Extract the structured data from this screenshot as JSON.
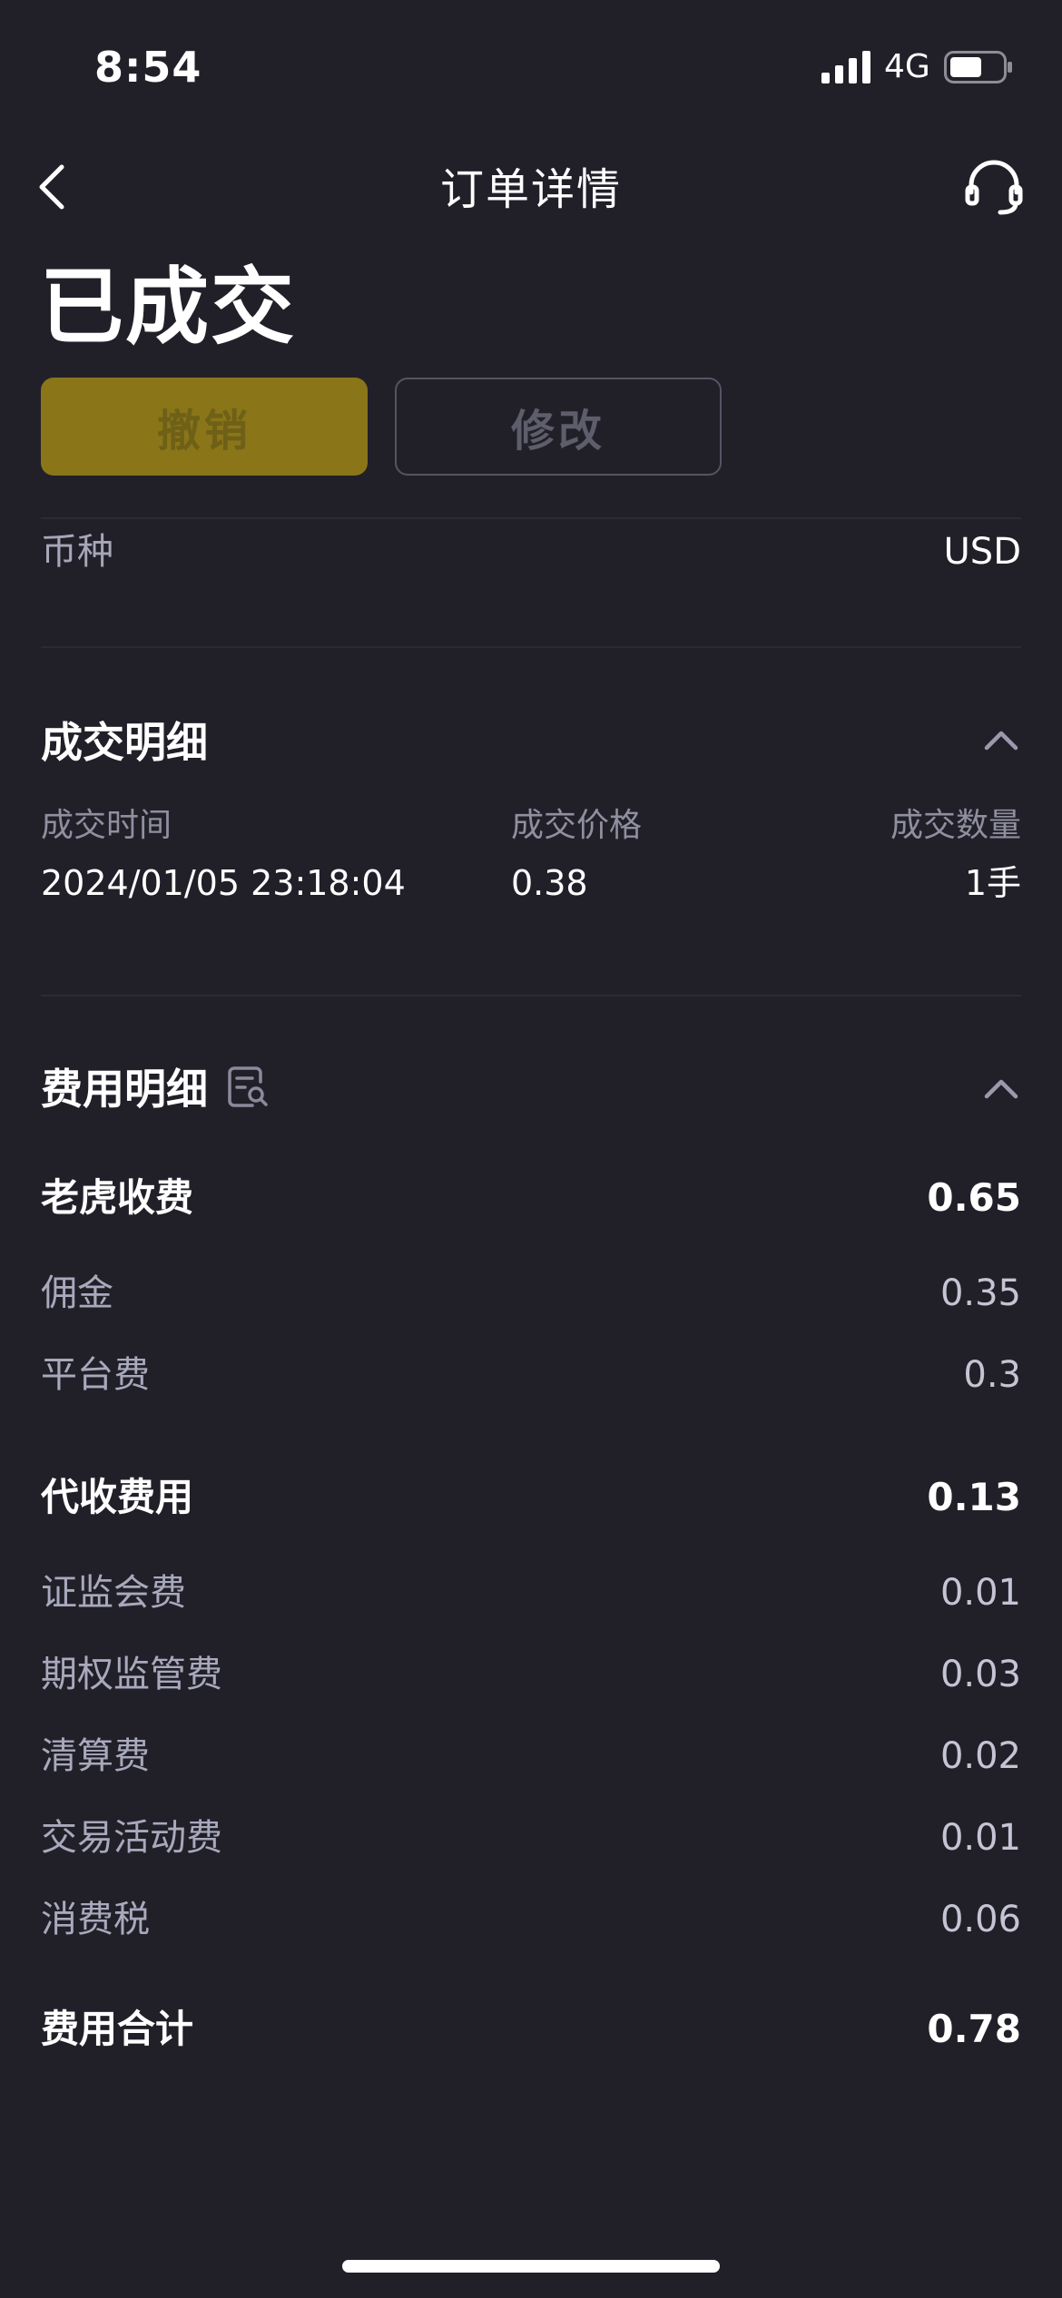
{
  "status_bar": {
    "time": "8:54",
    "network": "4G"
  },
  "nav": {
    "title": "订单详情",
    "back_icon": "chevron-left-icon",
    "support_icon": "headset-icon"
  },
  "order": {
    "status": "已成交",
    "cancel_label": "撤销",
    "modify_label": "修改",
    "currency_label": "币种",
    "currency_value": "USD"
  },
  "trade_details": {
    "title": "成交明细",
    "columns": [
      "成交时间",
      "成交价格",
      "成交数量"
    ],
    "rows": [
      {
        "time": "2024/01/05 23:18:04",
        "price": "0.38",
        "quantity": "1手"
      }
    ]
  },
  "fee_details": {
    "title": "费用明细",
    "info_icon": "document-search-icon",
    "tiger_fees": {
      "label": "老虎收费",
      "total": "0.65",
      "items": [
        {
          "label": "佣金",
          "value": "0.35"
        },
        {
          "label": "平台费",
          "value": "0.3"
        }
      ]
    },
    "collected_fees": {
      "label": "代收费用",
      "total": "0.13",
      "items": [
        {
          "label": "证监会费",
          "value": "0.01"
        },
        {
          "label": "期权监管费",
          "value": "0.03"
        },
        {
          "label": "清算费",
          "value": "0.02"
        },
        {
          "label": "交易活动费",
          "value": "0.01"
        },
        {
          "label": "消费税",
          "value": "0.06"
        }
      ]
    },
    "grand_total": {
      "label": "费用合计",
      "value": "0.78"
    }
  },
  "colors": {
    "background": "#212029",
    "cancel_button": "#8a7519",
    "muted_text": "#a6a6b8"
  }
}
